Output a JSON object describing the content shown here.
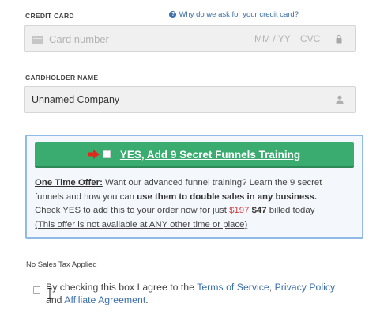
{
  "credit_card": {
    "label": "CREDIT CARD",
    "help_link": "Why do we ask for your credit card?",
    "help_icon": "question-circle-icon",
    "card_number_placeholder": "Card number",
    "expiry_placeholder": "MM / YY",
    "cvc_placeholder": "CVC",
    "card_icon": "credit-card-icon",
    "lock_icon": "lock-icon"
  },
  "cardholder": {
    "label": "CARDHOLDER NAME",
    "value": "Unnamed Company",
    "user_icon": "user-icon"
  },
  "offer": {
    "button_label": "YES, Add 9 Secret Funnels Training",
    "arrow_icon": "red-arrow-icon",
    "checked": false,
    "line1_prefix": "One Time Offer:",
    "line1_rest": " Want our advanced funnel training? Learn the 9 secret",
    "line2_pre": "funnels and how you can ",
    "line2_bold": "use them to double sales in any business.",
    "line3_pre": "Check YES to add this to your order now for just ",
    "old_price": "$197",
    "new_price": "$47",
    "line3_post": " billed today",
    "line4": "(This offer is not available at ANY other time or place)"
  },
  "tax_note": "No Sales Tax Applied",
  "agreement": {
    "prefix": "By checking this box I agree to the ",
    "terms_link": "Terms of Service",
    "separator": ", ",
    "privacy_link": "Privacy Policy",
    "and_text": "and ",
    "affiliate_link": "Affiliate Agreement",
    "suffix": ".",
    "checked": false
  },
  "colors": {
    "accent_green": "#3aac6f",
    "link_blue": "#3b6fa8",
    "offer_border": "#8fbbe6",
    "strike_red": "#d04040"
  }
}
